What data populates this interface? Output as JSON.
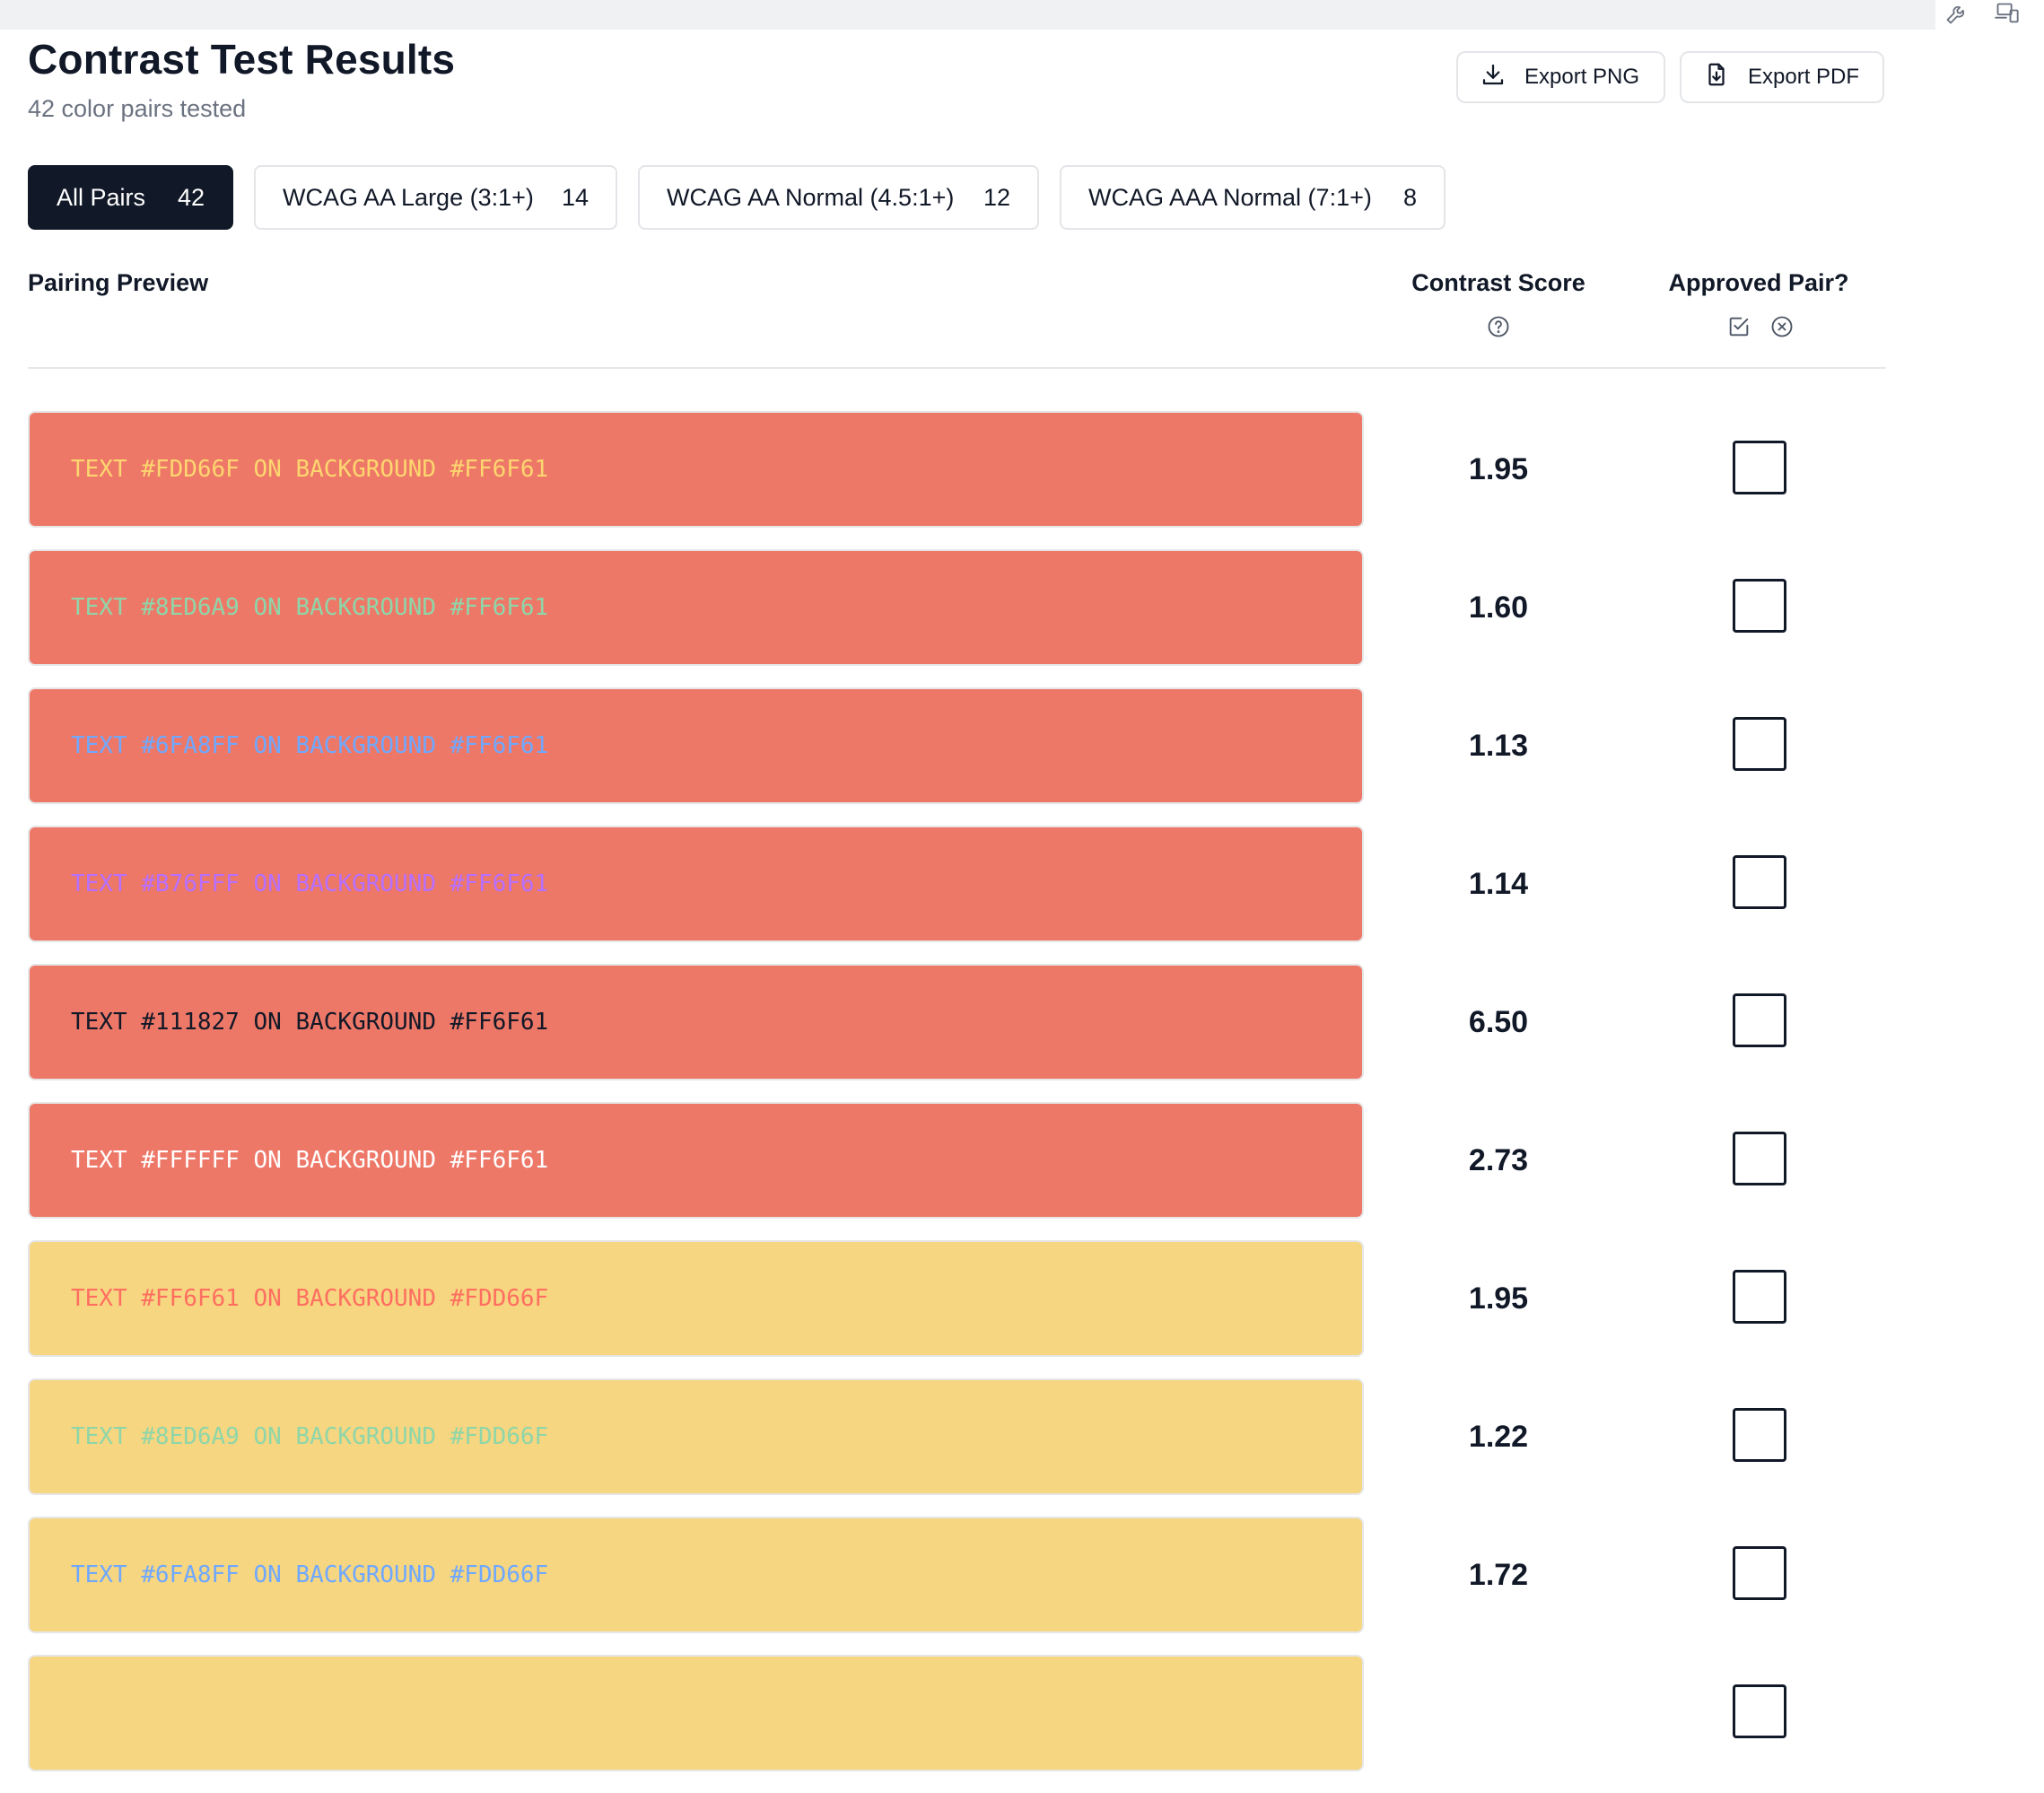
{
  "header": {
    "title": "Contrast Test Results",
    "subtitle": "42 color pairs tested"
  },
  "actions": {
    "export_png": {
      "label": "Export PNG",
      "icon": "download-icon"
    },
    "export_pdf": {
      "label": "Export PDF",
      "icon": "file-download-icon"
    }
  },
  "toolbar_icons": [
    "wrench-icon",
    "devices-icon"
  ],
  "filters": [
    {
      "label": "All Pairs",
      "count": "42",
      "active": true
    },
    {
      "label": "WCAG AA Large (3:1+)",
      "count": "14",
      "active": false
    },
    {
      "label": "WCAG AA Normal (4.5:1+)",
      "count": "12",
      "active": false
    },
    {
      "label": "WCAG AAA Normal (7:1+)",
      "count": "8",
      "active": false
    }
  ],
  "columns": {
    "preview": "Pairing Preview",
    "score": "Contrast Score",
    "approved": "Approved Pair?"
  },
  "header_icons": {
    "score": "help-circle-icon",
    "approved": [
      "checkbox-check-icon",
      "close-circle-icon"
    ]
  },
  "rows": [
    {
      "label": "TEXT #FDD66F ON BACKGROUND #FF6F61",
      "text_color": "#FDD66F",
      "bg_color": "#EE7868",
      "score": "1.95",
      "approved": false
    },
    {
      "label": "TEXT #8ED6A9 ON BACKGROUND #FF6F61",
      "text_color": "#8ED6A9",
      "bg_color": "#EE7868",
      "score": "1.60",
      "approved": false
    },
    {
      "label": "TEXT #6FA8FF ON BACKGROUND #FF6F61",
      "text_color": "#6FA8FF",
      "bg_color": "#EE7868",
      "score": "1.13",
      "approved": false
    },
    {
      "label": "TEXT #B76FFF ON BACKGROUND #FF6F61",
      "text_color": "#B76FFF",
      "bg_color": "#EE7868",
      "score": "1.14",
      "approved": false
    },
    {
      "label": "TEXT #111827 ON BACKGROUND #FF6F61",
      "text_color": "#111827",
      "bg_color": "#EE7868",
      "score": "6.50",
      "approved": false
    },
    {
      "label": "TEXT #FFFFFF ON BACKGROUND #FF6F61",
      "text_color": "#FFFFFF",
      "bg_color": "#EE7868",
      "score": "2.73",
      "approved": false
    },
    {
      "label": "TEXT #FF6F61 ON BACKGROUND #FDD66F",
      "text_color": "#FF6F61",
      "bg_color": "#F6D680",
      "score": "1.95",
      "approved": false
    },
    {
      "label": "TEXT #8ED6A9 ON BACKGROUND #FDD66F",
      "text_color": "#8ED6A9",
      "bg_color": "#F6D680",
      "score": "1.22",
      "approved": false
    },
    {
      "label": "TEXT #6FA8FF ON BACKGROUND #FDD66F",
      "text_color": "#6FA8FF",
      "bg_color": "#F6D680",
      "score": "1.72",
      "approved": false
    },
    {
      "label": "",
      "text_color": "#B76FFF",
      "bg_color": "#F6D680",
      "score": "",
      "approved": false
    }
  ]
}
